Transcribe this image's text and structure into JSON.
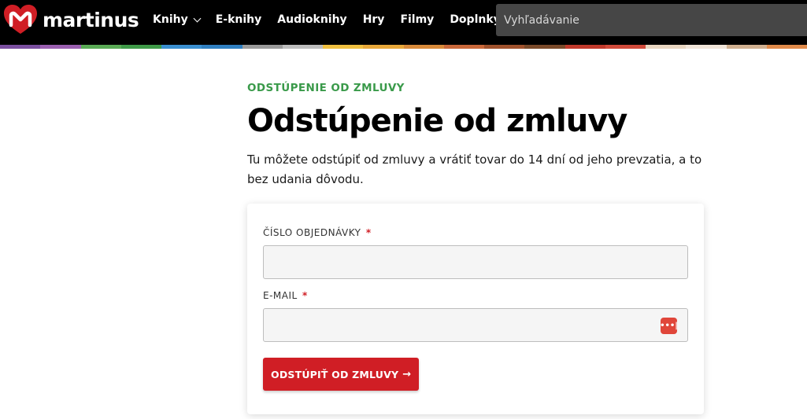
{
  "header": {
    "logo_text": "martinus",
    "nav": [
      {
        "label": "Knihy",
        "dropdown": true
      },
      {
        "label": "E-knihy",
        "dropdown": false
      },
      {
        "label": "Audioknihy",
        "dropdown": false
      },
      {
        "label": "Hry",
        "dropdown": false
      },
      {
        "label": "Filmy",
        "dropdown": false
      },
      {
        "label": "Doplnky",
        "dropdown": true
      }
    ],
    "search": {
      "placeholder": "Vyhľadávanie",
      "value": ""
    }
  },
  "stripe_colors": [
    "#7b4fa0",
    "#9b5fb0",
    "#5aaa55",
    "#3f9a48",
    "#3a8fd0",
    "#2f7fc0",
    "#9a9a9a",
    "#bdbdbd",
    "#f0c040",
    "#e8a83a",
    "#d88a3a",
    "#c9683a",
    "#a0522d",
    "#7a4a2a",
    "#c0392b",
    "#d04a3a",
    "#e8d5c0",
    "#f0e4d8",
    "#d0b090",
    "#e08a4a"
  ],
  "main": {
    "eyebrow": "ODSTÚPENIE OD ZMLUVY",
    "title": "Odstúpenie od zmluvy",
    "lead": "Tu môžete odstúpiť od zmluvy a vrátiť tovar do 14 dní od jeho prevzatia, a to bez udania dôvodu."
  },
  "form": {
    "order_label": "ČÍSLO OBJEDNÁVKY",
    "order_value": "",
    "email_label": "E-MAIL",
    "email_value": "",
    "required_mark": "*",
    "password_manager_glyph": "•••|",
    "submit_label": "ODSTÚPIŤ OD ZMLUVY",
    "submit_arrow": "→"
  },
  "colors": {
    "accent_red": "#d01e25",
    "eyebrow_green": "#3a9a4a",
    "header_bg": "#000000"
  },
  "icons": {
    "logo": "martinus-heart-logo-icon",
    "chevron": "chevron-down-icon",
    "password_manager": "password-manager-icon",
    "arrow": "arrow-right-icon"
  }
}
